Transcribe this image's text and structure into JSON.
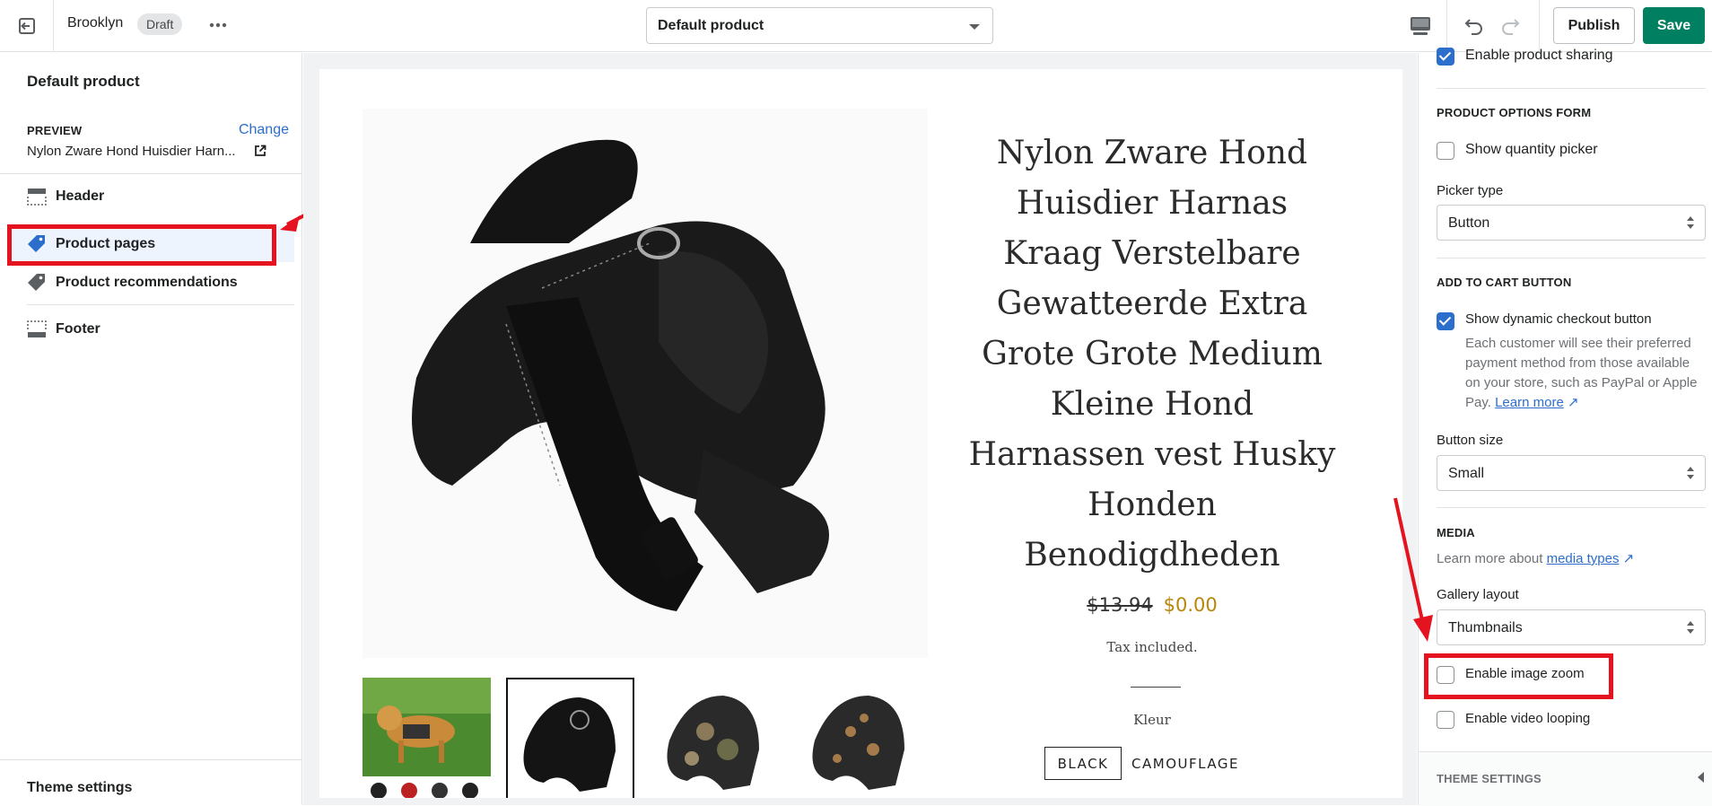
{
  "topbar": {
    "theme_name": "Brooklyn",
    "status_badge": "Draft",
    "template_select_value": "Default product",
    "publish_label": "Publish",
    "save_label": "Save"
  },
  "sidebar": {
    "title": "Default product",
    "preview_label": "PREVIEW",
    "change_label": "Change",
    "preview_product": "Nylon Zware Hond Huisdier Harn...",
    "items": [
      {
        "label": "Header",
        "icon": "header-section-icon"
      },
      {
        "label": "Product pages",
        "icon": "tag-icon"
      },
      {
        "label": "Product recommendations",
        "icon": "tag-icon"
      },
      {
        "label": "Footer",
        "icon": "footer-section-icon"
      }
    ],
    "theme_settings_label": "Theme settings"
  },
  "preview": {
    "product_title": "Nylon Zware Hond Huisdier Harnas Kraag Verstelbare Gewatteerde Extra Grote Grote Medium Kleine Hond Harnassen vest Husky Honden Benodigdheden",
    "price_old": "$13.94",
    "price_new": "$0.00",
    "tax_text": "Tax included.",
    "color_label": "Kleur",
    "swatches": [
      "BLACK",
      "CAMOUFLAGE"
    ]
  },
  "settings": {
    "enable_sharing_label": "Enable product sharing",
    "options_form_heading": "PRODUCT OPTIONS FORM",
    "show_quantity_label": "Show quantity picker",
    "picker_type_label": "Picker type",
    "picker_type_value": "Button",
    "add_to_cart_heading": "ADD TO CART BUTTON",
    "dynamic_checkout_label": "Show dynamic checkout button",
    "dynamic_help_text": "Each customer will see their preferred payment method from those available on your store, such as PayPal or Apple Pay.",
    "learn_more_label": "Learn more",
    "button_size_label": "Button size",
    "button_size_value": "Small",
    "media_heading": "MEDIA",
    "media_help_prefix": "Learn more about",
    "media_types_link": "media types",
    "gallery_layout_label": "Gallery layout",
    "gallery_layout_value": "Thumbnails",
    "image_zoom_label": "Enable image zoom",
    "video_looping_label": "Enable video looping",
    "theme_settings_heading": "THEME SETTINGS"
  },
  "colors": {
    "accent_blue": "#2c6ecb",
    "save_green": "#008060",
    "highlight_red": "#e5121f",
    "sale_price": "#b8860b"
  }
}
